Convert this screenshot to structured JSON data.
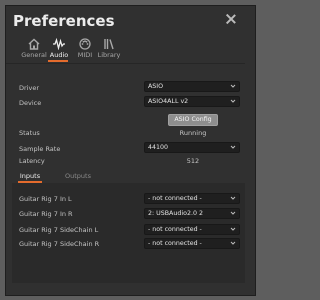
{
  "dialog": {
    "title": "Preferences"
  },
  "tabs": [
    {
      "icon": "home-icon",
      "label": "General"
    },
    {
      "icon": "audio-waveform-icon",
      "label": "Audio",
      "active": true
    },
    {
      "icon": "midi-icon",
      "label": "MIDI"
    },
    {
      "icon": "library-icon",
      "label": "Library"
    }
  ],
  "settings": {
    "driver_label": "Driver",
    "driver_value": "ASIO",
    "device_label": "Device",
    "device_value": "ASIO4ALL v2",
    "asio_config_label": "ASIO Config",
    "status_label": "Status",
    "status_value": "Running",
    "sample_rate_label": "Sample Rate",
    "sample_rate_value": "44100",
    "latency_label": "Latency",
    "latency_value": "512"
  },
  "io_tabs": {
    "inputs": "Inputs",
    "outputs": "Outputs"
  },
  "inputs": [
    {
      "name": "Guitar Rig 7 In L",
      "value": "- not connected -"
    },
    {
      "name": "Guitar Rig 7 In R",
      "value": "2: USBAudio2.0 2"
    },
    {
      "name": "Guitar Rig 7 SideChain L",
      "value": "- not connected -"
    },
    {
      "name": "Guitar Rig 7 SideChain R",
      "value": "- not connected -"
    }
  ],
  "colors": {
    "accent": "#e36b2d",
    "background": "#303030",
    "field": "#1f1f1f"
  }
}
